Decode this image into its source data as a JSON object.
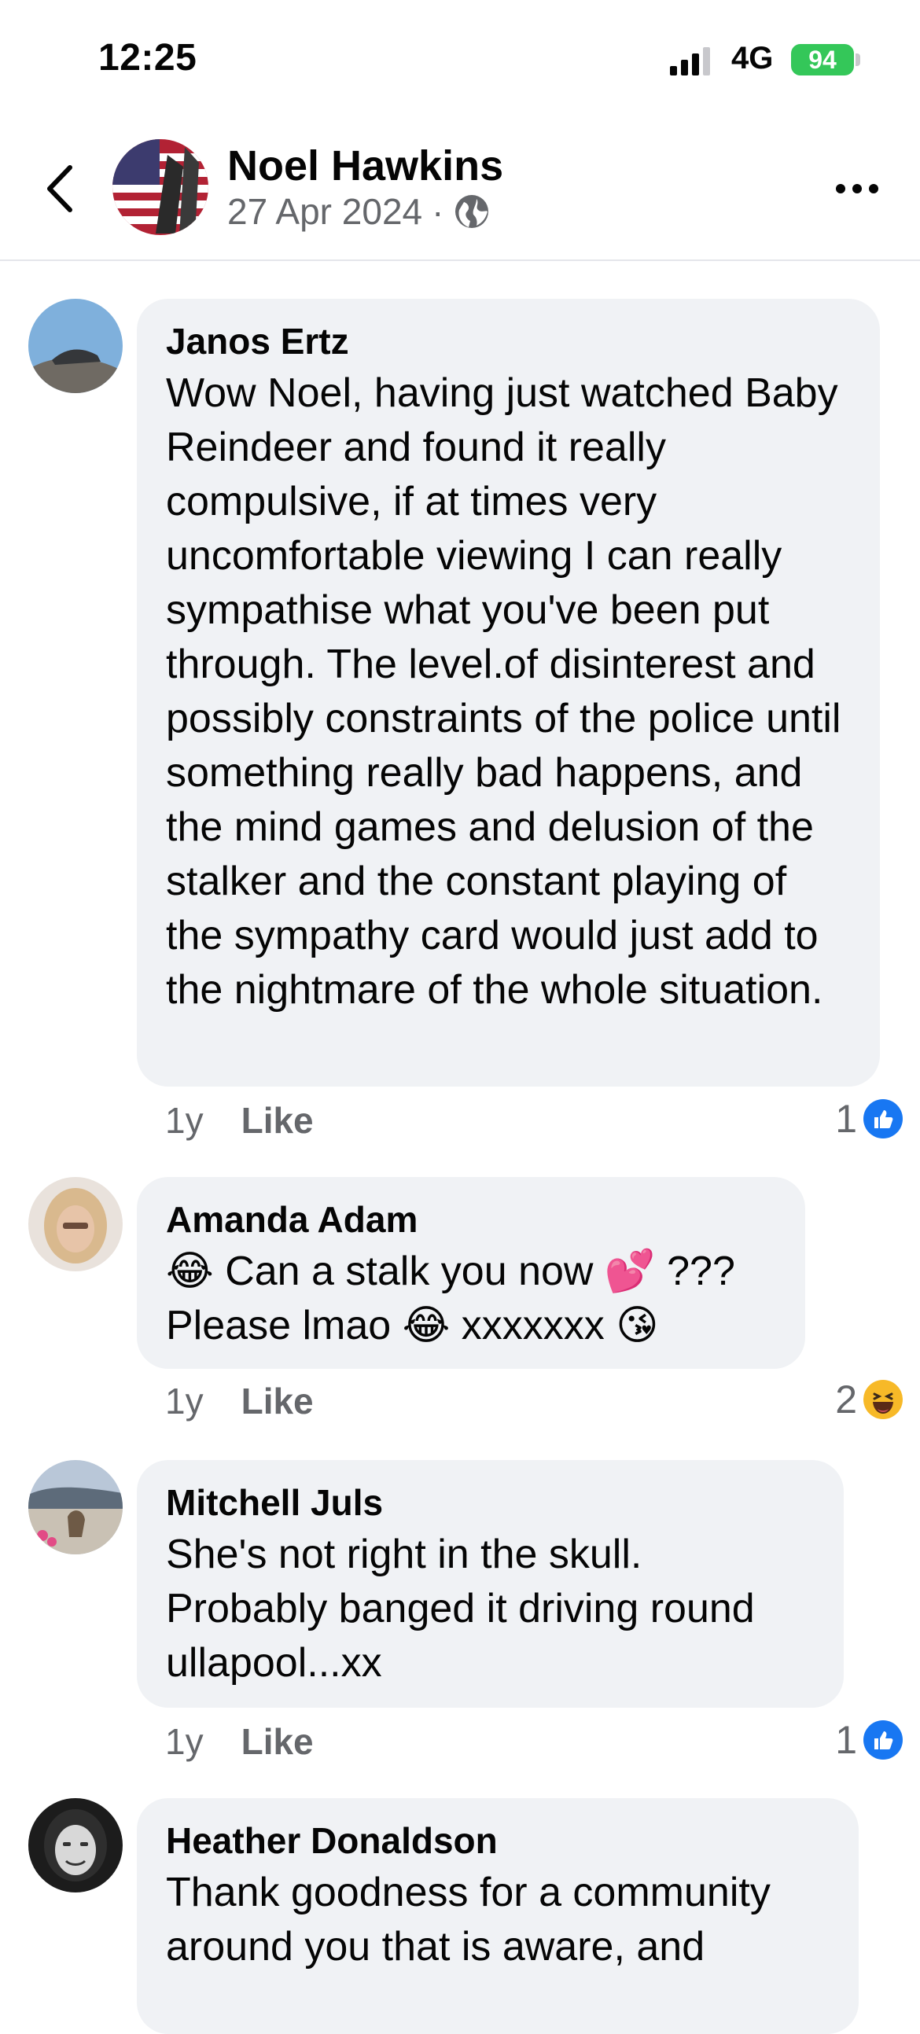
{
  "status_bar": {
    "time": "12:25",
    "network": "4G",
    "battery": "94"
  },
  "header": {
    "name": "Noel Hawkins",
    "date": "27 Apr 2024",
    "separator": "·"
  },
  "comments": [
    {
      "author": "Janos Ertz",
      "text": "Wow Noel, having just watched Baby Reindeer and found it really compulsive, if at times very uncomfortable viewing I can really sympathise what you've been put through. The level.of disinterest and possibly constraints of the police until something really bad happens, and the mind games and delusion of the stalker and the constant playing of the sympathy card would just add to the nightmare of the whole situation.",
      "time": "1y",
      "like_label": "Like",
      "reaction_count": "1",
      "reaction_icon": "like-icon"
    },
    {
      "author": "Amanda Adam",
      "text": "😂 Can a stalk you now 💕 ???\nPlease lmao 😂 xxxxxxx 😘",
      "time": "1y",
      "like_label": "Like",
      "reaction_count": "2",
      "reaction_icon": "haha-icon"
    },
    {
      "author": "Mitchell Juls",
      "text": "She's not right in the skull.\nProbably banged it driving round ullapool...xx",
      "time": "1y",
      "like_label": "Like",
      "reaction_count": "1",
      "reaction_icon": "like-icon"
    },
    {
      "author": "Heather Donaldson",
      "text": "Thank goodness for a community around you that is aware, and",
      "time": "",
      "like_label": "",
      "reaction_count": "",
      "reaction_icon": ""
    }
  ],
  "colors": {
    "accent": "#1877f2",
    "bubble": "#f0f2f5",
    "meta_text": "#65676b",
    "battery": "#34c759"
  }
}
